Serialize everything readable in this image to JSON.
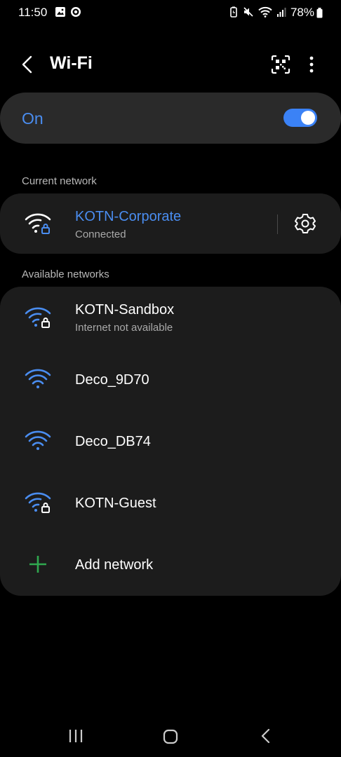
{
  "status_bar": {
    "time": "11:50",
    "battery": "78%",
    "left_icons": [
      "gallery-icon",
      "record-icon"
    ],
    "right_icons": [
      "battery-saver-icon",
      "mute-icon",
      "wifi-signal-icon",
      "cell-signal-icon"
    ]
  },
  "app_bar": {
    "title": "Wi-Fi",
    "back_icon": "chevron-left-icon",
    "qr_icon": "qr-scan-icon",
    "more_icon": "more-vert-icon"
  },
  "wifi_toggle": {
    "label": "On",
    "enabled": true
  },
  "current_network": {
    "section_label": "Current network",
    "name": "KOTN-Corporate",
    "status": "Connected",
    "secured": true,
    "settings_icon": "gear-icon"
  },
  "available_networks": {
    "section_label": "Available networks",
    "items": [
      {
        "name": "KOTN-Sandbox",
        "status": "Internet not available",
        "secured": true
      },
      {
        "name": "Deco_9D70",
        "secured": false
      },
      {
        "name": "Deco_DB74",
        "secured": false
      },
      {
        "name": "KOTN-Guest",
        "secured": true
      }
    ],
    "add_label": "Add network"
  },
  "nav_bar": {
    "icons": [
      "recent-apps-icon",
      "home-icon",
      "back-icon"
    ]
  },
  "colors": {
    "accent": "#4a8df0",
    "switch_on": "#3b82f6",
    "card": "#1c1c1c",
    "toggle_card": "#2a2a2a",
    "add_icon": "#2fa84f"
  }
}
